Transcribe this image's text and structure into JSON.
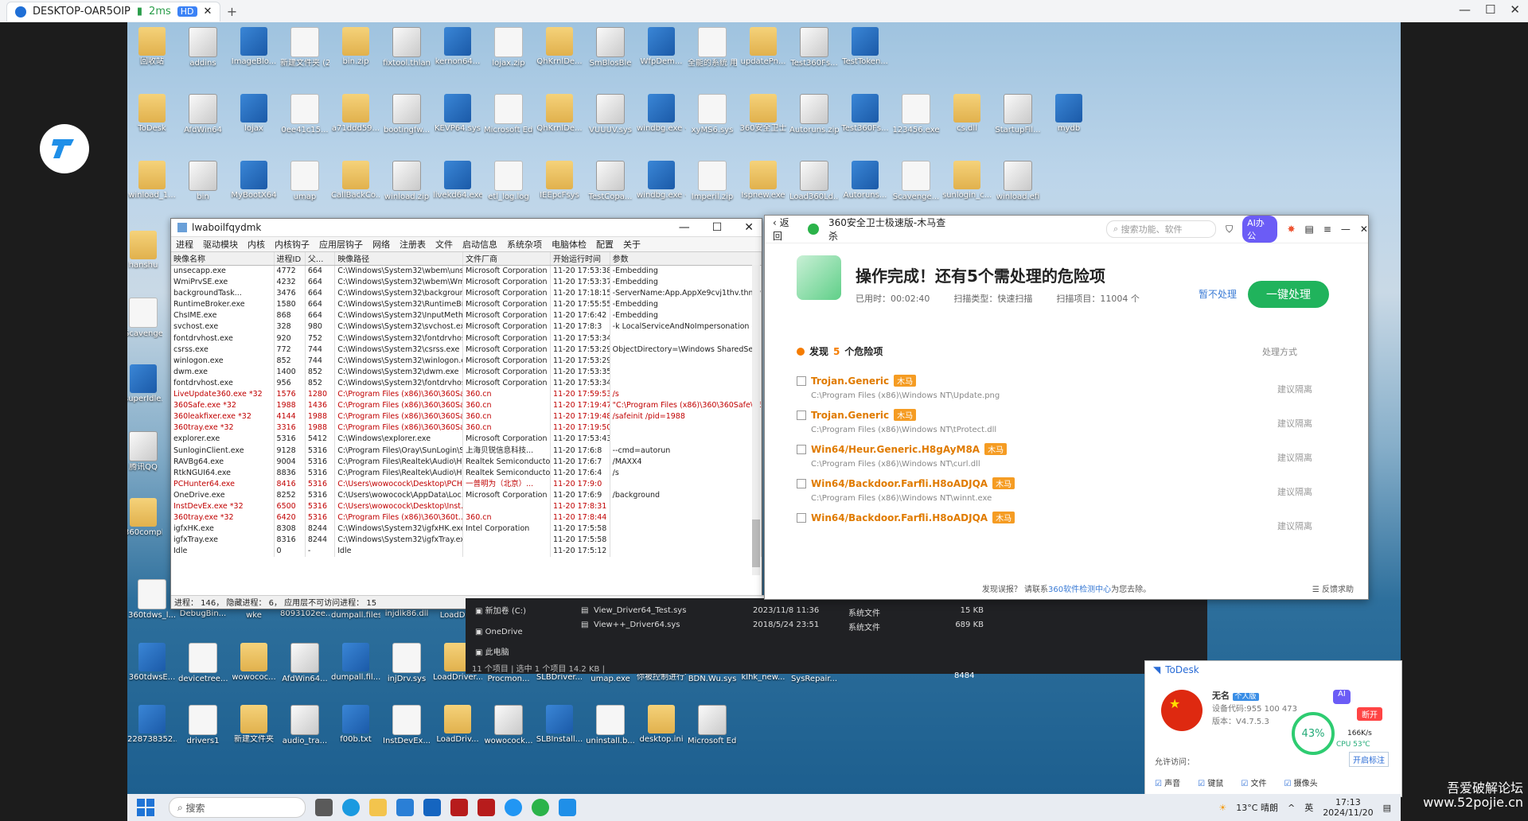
{
  "outer": {
    "tab_title": "DESKTOP-OAR5OIP",
    "ping": "2ms",
    "hd": "HD"
  },
  "desktop_icons": {
    "row1": [
      "回收站",
      "addins",
      "ImageBlo...",
      "新建文件夹 (2)",
      "bin.zip",
      "fixtool.thlan",
      "kernon64...",
      "lojax.zip",
      "QhKrnlDe...",
      "SmBlosBle",
      "WfpDem...",
      "全能的系统 用.html",
      "updatePn...",
      "Test360Fs...",
      "TestToken..."
    ],
    "row2": [
      "ToDesk",
      "AfdWin64",
      "lojax",
      "0ee41c15...",
      "a71ddd59...",
      "bootingfw...",
      "KEVP64.sys",
      "Microsoft Edge",
      "QhKrnlDe...",
      "VUUUV.sys",
      "windbg.exe - 快捷方式",
      "xyMS6.sys",
      "360安全卫士",
      "Autoruns.zip",
      "Test360Fs...",
      "123456.exe",
      "cs.dll",
      "StartupFil...",
      "mydb"
    ],
    "row3": [
      "winload_1...",
      "bin",
      "MyBootX64",
      "umap",
      "CallBackCo...",
      "winload.zip",
      "livekd64.exe - 快捷方式",
      "etl_log.log",
      "IEEpcFsys",
      "TestCopa...",
      "windbg.exe - 快捷方式",
      "Imperil.zip",
      "Ispnew.exe",
      "Load360Ld...",
      "Autoruns...",
      "Scavenge...",
      "sunlogin_c...",
      "winload.efi"
    ],
    "left_col": [
      "hanshu",
      "Scavenger",
      "superIdle...",
      "腾讯QQ",
      "360compl..."
    ],
    "row_lower": [
      "360tdws_l...",
      "DebugBin...",
      "wke",
      "8093102ee... 无损力合击...",
      "dumpall.files (2).log",
      "injdlk86.dll",
      "LoadDr..."
    ],
    "row_lower2": [
      "360tdwsE...",
      "devicetree...",
      "wowococ...",
      "AfdWin64...",
      "dumpall.fil...",
      "injDrv.sys",
      "LoadDriver... - 快捷方式",
      "Procmon...",
      "SLBDriver...",
      "umap.exe",
      "你被控制进行? 你被删除...",
      "BDN.Wu.sys",
      "klhk_new...",
      "SysRepair..."
    ],
    "row_bottom": [
      "228738352...",
      "drivers1",
      "新建文件夹",
      "audio_tra...",
      "f00b.txt",
      "InstDevEx...",
      "LoadDriv...",
      "wowocock...",
      "SLBInstall...",
      "uninstall.b...",
      "desktop.ini",
      "Microsoft Edge"
    ]
  },
  "proc_window": {
    "title": "lwaboilfqydmk",
    "menu": [
      "进程",
      "驱动模块",
      "内核",
      "内核钩子",
      "应用层钩子",
      "网络",
      "注册表",
      "文件",
      "启动信息",
      "系统杂项",
      "电脑体检",
      "配置",
      "关于"
    ],
    "columns": [
      "映像名称",
      "进程ID",
      "父...",
      "映像路径",
      "文件厂商",
      "开始运行时间",
      "参数"
    ],
    "rows": [
      [
        "unsecapp.exe",
        "4772",
        "664",
        "C:\\Windows\\System32\\wbem\\uns...",
        "Microsoft Corporation",
        "11-20 17:53:38",
        "-Embedding",
        "n"
      ],
      [
        "WmiPrvSE.exe",
        "4232",
        "664",
        "C:\\Windows\\System32\\wbem\\Wmi...",
        "Microsoft Corporation",
        "11-20 17:53:37",
        "-Embedding",
        "n"
      ],
      [
        "backgroundTask...",
        "3476",
        "664",
        "C:\\Windows\\System32\\backgroun...",
        "Microsoft Corporation",
        "11-20 17:18:15",
        "-ServerName:App.AppXe9cvj1thv.thmcw0c",
        "n"
      ],
      [
        "RuntimeBroker.exe",
        "1580",
        "664",
        "C:\\Windows\\System32\\RuntimeBr...",
        "Microsoft Corporation",
        "11-20 17:55:55",
        "-Embedding",
        "n"
      ],
      [
        "ChsIME.exe",
        "868",
        "664",
        "C:\\Windows\\System32\\InputMeth...",
        "Microsoft Corporation",
        "11-20 17:6:42",
        "-Embedding",
        "n"
      ],
      [
        "svchost.exe",
        "328",
        "980",
        "C:\\Windows\\System32\\svchost.exe",
        "Microsoft Corporation",
        "11-20 17:8:3",
        "-k LocalServiceAndNoImpersonation -p -s S",
        "n"
      ],
      [
        "fontdrvhost.exe",
        "920",
        "752",
        "C:\\Windows\\System32\\fontdrvhos...",
        "Microsoft Corporation",
        "11-20 17:53:34",
        "",
        "n"
      ],
      [
        "csrss.exe",
        "772",
        "744",
        "C:\\Windows\\System32\\csrss.exe",
        "Microsoft Corporation",
        "11-20 17:53:29",
        "ObjectDirectory=\\Windows SharedSection=",
        "n"
      ],
      [
        "winlogon.exe",
        "852",
        "744",
        "C:\\Windows\\System32\\winlogon.exe",
        "Microsoft Corporation",
        "11-20 17:53:29",
        "",
        "n"
      ],
      [
        "dwm.exe",
        "1400",
        "852",
        "C:\\Windows\\System32\\dwm.exe",
        "Microsoft Corporation",
        "11-20 17:53:35",
        "",
        "n"
      ],
      [
        "fontdrvhost.exe",
        "956",
        "852",
        "C:\\Windows\\System32\\fontdrvhos...",
        "Microsoft Corporation",
        "11-20 17:53:34",
        "",
        "n"
      ],
      [
        "LiveUpdate360.exe *32",
        "1576",
        "1280",
        "C:\\Program Files (x86)\\360\\360Sa...",
        "360.cn",
        "11-20 17:59:53",
        "/s",
        "r"
      ],
      [
        "360Safe.exe *32",
        "1988",
        "1436",
        "C:\\Program Files (x86)\\360\\360Sa...",
        "360.cn",
        "11-20 17:19:47",
        "\"C:\\Program Files (x86)\\360\\360Safe\\360S",
        "r"
      ],
      [
        "360leakfixer.exe *32",
        "4144",
        "1988",
        "C:\\Program Files (x86)\\360\\360Sa...",
        "360.cn",
        "11-20 17:19:48",
        "/safeinit /pid=1988",
        "r"
      ],
      [
        "360tray.exe *32",
        "3316",
        "1988",
        "C:\\Program Files (x86)\\360\\360Sa...",
        "360.cn",
        "11-20 17:19:50",
        "",
        "r"
      ],
      [
        "explorer.exe",
        "5316",
        "5412",
        "C:\\Windows\\explorer.exe",
        "Microsoft Corporation",
        "11-20 17:53:43",
        "",
        "n"
      ],
      [
        "SunloginClient.exe",
        "9128",
        "5316",
        "C:\\Program Files\\Oray\\SunLogin\\S...",
        "上海贝锐信息科技...",
        "11-20 17:6:8",
        "--cmd=autorun",
        "n"
      ],
      [
        "RAVBg64.exe",
        "9004",
        "5316",
        "C:\\Program Files\\Realtek\\Audio\\H...",
        "Realtek Semiconductor",
        "11-20 17:6:7",
        "/MAXX4",
        "n"
      ],
      [
        "RtkNGUI64.exe",
        "8836",
        "5316",
        "C:\\Program Files\\Realtek\\Audio\\H...",
        "Realtek Semiconductor",
        "11-20 17:6:4",
        "/s",
        "n"
      ],
      [
        "PCHunter64.exe",
        "8416",
        "5316",
        "C:\\Users\\wowocock\\Desktop\\PCH...",
        "一普明为（北京）...",
        "11-20 17:9:0",
        "",
        "r"
      ],
      [
        "OneDrive.exe",
        "8252",
        "5316",
        "C:\\Users\\wowocock\\AppData\\Loc...",
        "Microsoft Corporation",
        "11-20 17:6:9",
        "/background",
        "n"
      ],
      [
        "InstDevEx.exe *32",
        "6500",
        "5316",
        "C:\\Users\\wowocock\\Desktop\\Inst...",
        "",
        "11-20 17:8:31",
        "",
        "r"
      ],
      [
        "360tray.exe *32",
        "6420",
        "5316",
        "C:\\Program Files (x86)\\360\\360t...",
        "360.cn",
        "11-20 17:8:44",
        "",
        "r"
      ],
      [
        "igfxHK.exe",
        "8308",
        "8244",
        "C:\\Windows\\System32\\igfxHK.exe",
        "Intel Corporation",
        "11-20 17:5:58",
        "",
        "n"
      ],
      [
        "igfxTray.exe",
        "8316",
        "8244",
        "C:\\Windows\\System32\\igfxTray.exe",
        "",
        "11-20 17:5:58",
        "",
        "n"
      ],
      [
        "Idle",
        "0",
        "-",
        "Idle",
        "",
        "11-20 17:5:12",
        "",
        "n"
      ]
    ],
    "status": "进程： 146， 隐藏进程： 6， 应用层不可访问进程： 15"
  },
  "safe360": {
    "back": "返回",
    "title": "360安全卫士极速版-木马查杀",
    "search_placeholder": "搜索功能、软件",
    "ai_badge": "AI办公",
    "result_title": "操作完成！还有5个需处理的危险项",
    "elapsed": "已用时：00:02:40",
    "scan_type": "扫描类型：快速扫描",
    "scan_items": "扫描项目：11004 个",
    "ignore": "暂不处理",
    "one_key": "一键处理",
    "found_prefix": "发现",
    "found_count": "5",
    "found_suffix": "个危险项",
    "method_header": "处理方式",
    "tag": "木马",
    "action": "建议隔离",
    "risks": [
      {
        "name": "Trojan.Generic",
        "path": "C:\\Program Files (x86)\\Windows NT\\Update.png"
      },
      {
        "name": "Trojan.Generic",
        "path": "C:\\Program Files (x86)\\Windows NT\\tProtect.dll"
      },
      {
        "name": "Win64/Heur.Generic.H8gAyM8A",
        "path": "C:\\Program Files (x86)\\Windows NT\\curl.dll"
      },
      {
        "name": "Win64/Backdoor.Farfli.H8oADJQA",
        "path": "C:\\Program Files (x86)\\Windows NT\\winnt.exe"
      },
      {
        "name": "Win64/Backdoor.Farfli.H8oADJQA",
        "path": ""
      }
    ],
    "footer_prefix": "发现误报？ 请联系",
    "footer_link": "360软件检测中心",
    "footer_suffix": "为您去除。",
    "feedback": "反馈求助"
  },
  "explorer": {
    "nav": [
      "新加卷 (C:)",
      "OneDrive",
      "此电脑"
    ],
    "files": [
      {
        "name": "View_Driver64_Test.sys",
        "date": "2023/11/8 11:36",
        "type": "系统文件",
        "size": "15 KB"
      },
      {
        "name": "View++_Driver64.sys",
        "date": "2018/5/24 23:51",
        "type": "系统文件",
        "size": "689 KB"
      }
    ],
    "status": "11 个项目  |  选中 1 个项目  14.2 KB  |",
    "extra": "8484"
  },
  "todesk": {
    "title": "ToDesk",
    "name": "无名",
    "badge": "个人版",
    "device_code": "设备代码:955 100 473",
    "version": "版本：V4.7.5.3",
    "percent": "43%",
    "net": "166K/s",
    "cpu": "CPU 53℃",
    "disconnect": "断开",
    "allow": "允许访问：",
    "open_notes": "开启标注",
    "perms": [
      "声音",
      "键鼠",
      "文件",
      "摄像头"
    ]
  },
  "taskbar": {
    "search": "搜索",
    "weather": "13°C 晴朗",
    "ime": "英",
    "time": "17:13",
    "date": "2024/11/20"
  },
  "watermark": {
    "line1": "吾爱破解论坛",
    "line2": "www.52pojie.cn"
  }
}
